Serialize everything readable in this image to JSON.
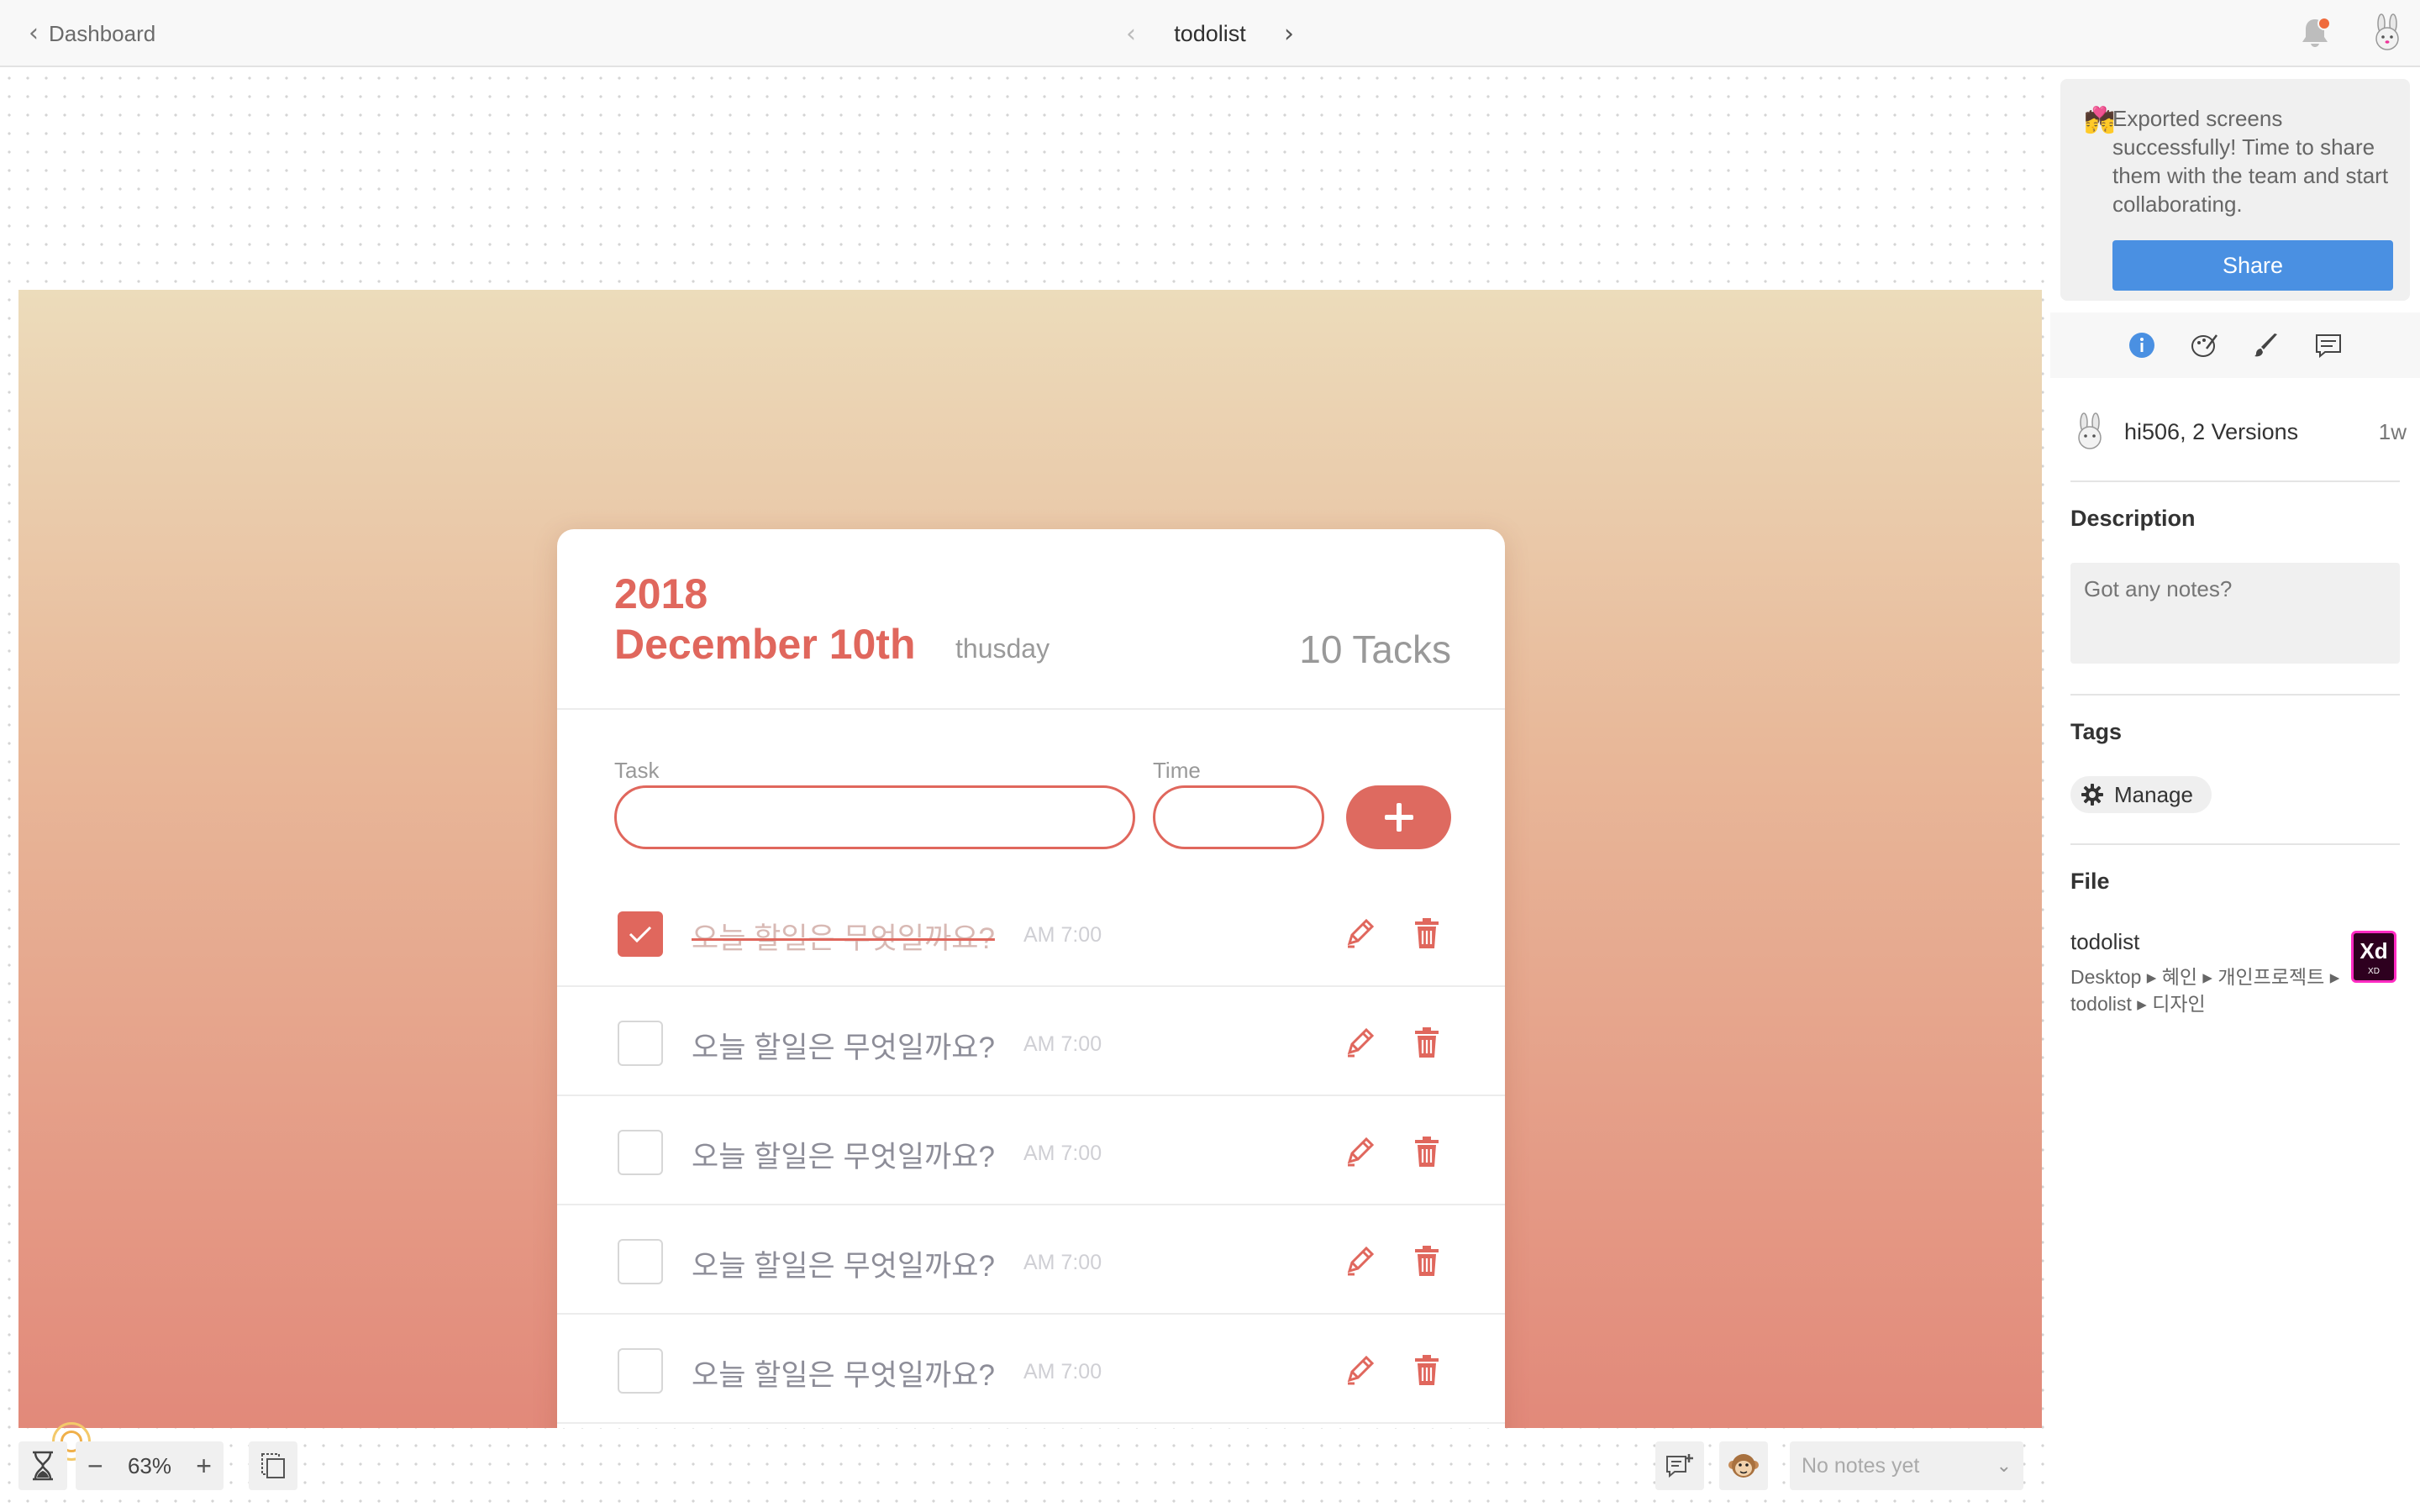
{
  "topbar": {
    "back_label": "Dashboard",
    "doc_title": "todolist"
  },
  "card": {
    "year": "2018",
    "date": "December 10th",
    "weekday": "thusday",
    "task_count": "10 Tacks",
    "task_label": "Task",
    "time_label": "Time"
  },
  "tasks": [
    {
      "text": "오늘 할일은 무엇일까요?",
      "time": "AM 7:00",
      "done": true
    },
    {
      "text": "오늘 할일은 무엇일까요?",
      "time": "AM 7:00",
      "done": false
    },
    {
      "text": "오늘 할일은 무엇일까요?",
      "time": "AM 7:00",
      "done": false
    },
    {
      "text": "오늘 할일은 무엇일까요?",
      "time": "AM 7:00",
      "done": false
    },
    {
      "text": "오늘 할일은 무엇일까요?",
      "time": "AM 7:00",
      "done": false
    }
  ],
  "bottom": {
    "zoom": "63%",
    "notes_placeholder": "No notes yet"
  },
  "panel": {
    "toast_emoji": "💏",
    "toast_text": "Exported screens successfully! Time to share them with the team and start collaborating.",
    "share_label": "Share",
    "owner": "hi506, 2 Versions",
    "owner_time": "1w",
    "description_title": "Description",
    "description_placeholder": "Got any notes?",
    "tags_title": "Tags",
    "manage_label": "Manage",
    "file_title": "File",
    "file_name": "todolist",
    "file_path": "Desktop ▸ 혜인 ▸ 개인프로젝트 ▸ todolist ▸ 디자인",
    "xd_label": "Xd",
    "xd_sub": "XD"
  },
  "colors": {
    "accent": "#e0675d",
    "share_blue": "#4a90e2",
    "notification": "#ef6b3d"
  },
  "icons": [
    "chevron-left-icon",
    "chevron-right-icon",
    "bell-icon",
    "bunny-avatar-icon",
    "plus-icon",
    "check-icon",
    "pencil-icon",
    "trash-icon",
    "hourglass-icon",
    "minus-icon",
    "artboard-icon",
    "add-note-icon",
    "monkey-icon",
    "info-icon",
    "palette-icon",
    "brush-icon",
    "comment-icon",
    "gear-icon",
    "xd-file-icon"
  ]
}
